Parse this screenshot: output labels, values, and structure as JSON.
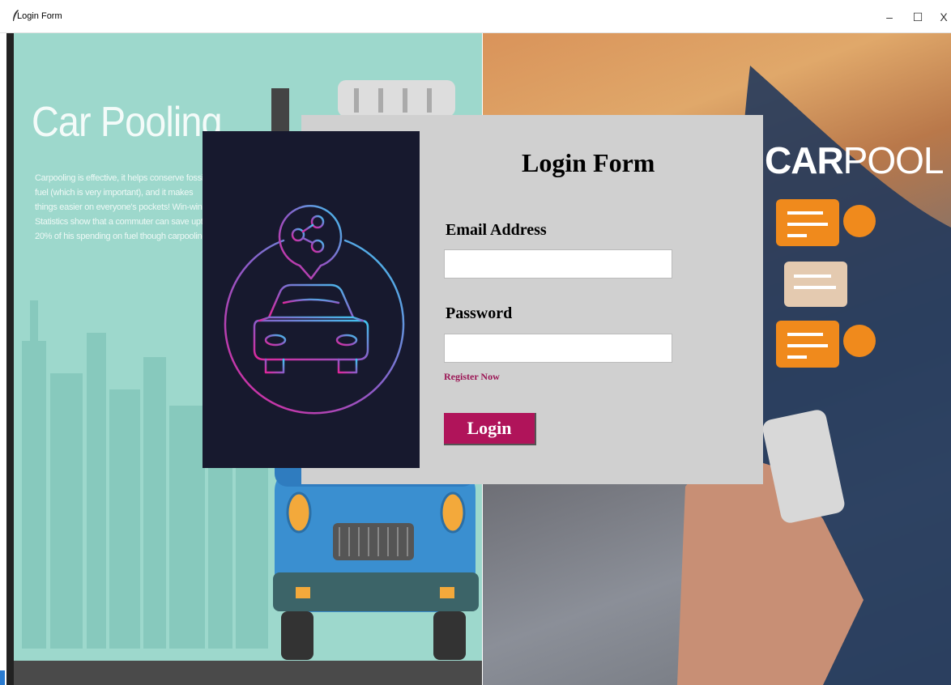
{
  "window": {
    "title": "Login Form",
    "minimize": "–",
    "maximize": "☐",
    "close": "X"
  },
  "left_banner": {
    "title": "Car Pooling",
    "text": "Carpooling is effective, it helps conserve fossil fuel (which is very important), and it makes things easier on everyone's pockets! Win-win! Statistics show that a commuter can save upto 20% of his spending on fuel though carpooling."
  },
  "right_photo": {
    "brand_bold": "CAR",
    "brand_rest": "POOL"
  },
  "form": {
    "title": "Login Form",
    "email_label": "Email Address",
    "email_value": "",
    "password_label": "Password",
    "password_value": "",
    "register_link": "Register Now",
    "login_button": "Login"
  },
  "colors": {
    "accent": "#b0145a",
    "panel_bg": "#d0d0d0",
    "card_bg": "#17192e",
    "banner_bg": "#9dd8cc"
  }
}
